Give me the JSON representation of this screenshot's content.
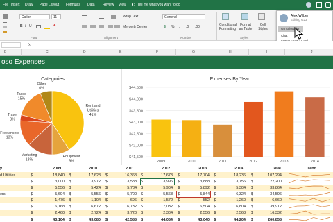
{
  "ribbon_tabs": [
    "File",
    "Insert",
    "Draw",
    "Page Layout",
    "Formulas",
    "Data",
    "Review",
    "View",
    "Help"
  ],
  "tell_me": "Tell me what you want to do",
  "ribbon": {
    "font_name": "Calibri",
    "font_size": "11",
    "wrap_text": "Wrap Text",
    "number_format": "General",
    "merge_center": "Merge & Center",
    "conditional_formatting": "Conditional Formatting",
    "format_as_table": "Format as Table",
    "cell_styles": "Cell Styles",
    "groups": [
      "Font",
      "Alignment",
      "Number",
      "Styles"
    ]
  },
  "presence": {
    "name": "Alex Wilber",
    "status": "Editing G23",
    "goto": "Go to location",
    "chat": "Chat",
    "open": "Open Contact Card"
  },
  "columns": [
    "B",
    "C",
    "D",
    "E",
    "F",
    "G",
    "H",
    "I",
    "J"
  ],
  "banner_title": "oso Expenses",
  "pie": {
    "title": "Categories",
    "slices": [
      {
        "label": "Rent and Utilities",
        "pct": "41%",
        "value": 41,
        "color": "#f9c30f"
      },
      {
        "label": "Equipment",
        "pct": "9%",
        "value": 9,
        "color": "#e5a43d"
      },
      {
        "label": "Marketing",
        "pct": "13%",
        "value": 13,
        "color": "#c8643b"
      },
      {
        "label": "Freelancers",
        "pct": "13%",
        "value": 13,
        "color": "#e9672a"
      },
      {
        "label": "Travel",
        "pct": "3%",
        "value": 3,
        "color": "#d9451c"
      },
      {
        "label": "Taxes",
        "pct": "15%",
        "value": 15,
        "color": "#f08a2b"
      },
      {
        "label": "Other",
        "pct": "6%",
        "value": 6,
        "color": "#b18817"
      }
    ]
  },
  "chart_data": {
    "type": "bar",
    "title": "Expenses By Year",
    "categories": [
      "2009",
      "2010",
      "2011",
      "2012",
      "2013",
      "2014"
    ],
    "values": [
      43104,
      43080,
      42885,
      43871,
      44332,
      44075
    ],
    "colors": [
      "#f9c30f",
      "#f5b013",
      "#d88f3c",
      "#e2571e",
      "#f07c1e",
      "#c96b47"
    ],
    "yticks": [
      "$44,500",
      "$44,000",
      "$43,500",
      "$43,000",
      "$42,500",
      "$42,000",
      "$41,500"
    ],
    "ylim": [
      41500,
      44500
    ],
    "xlabel": "",
    "ylabel": ""
  },
  "table": {
    "headers": [
      "y",
      "2009",
      "2010",
      "2011",
      "2012",
      "2013",
      "2014",
      "Total",
      "Trend"
    ],
    "rows": [
      {
        "label": "d Utilities",
        "values": [
          "18,840",
          "17,628",
          "16,368",
          "17,678",
          "17,704",
          "18,236"
        ],
        "total": "107,294"
      },
      {
        "label": "",
        "values": [
          "3,000",
          "3,972",
          "3,588",
          "3,996",
          "3,888",
          "3,756"
        ],
        "total": "22,200"
      },
      {
        "label": "",
        "values": [
          "5,556",
          "5,424",
          "5,784",
          "5,904",
          "5,892",
          "5,304"
        ],
        "total": "33,864"
      },
      {
        "label": "ers",
        "values": [
          "5,604",
          "5,556",
          "5,700",
          "5,568",
          "5,844",
          "6,324"
        ],
        "total": "34,596"
      },
      {
        "label": "",
        "values": [
          "1,476",
          "1,104",
          "696",
          "1,572",
          "552",
          "1,260"
        ],
        "total": "6,660"
      },
      {
        "label": "",
        "values": [
          "6,168",
          "6,672",
          "6,732",
          "7,032",
          "6,504",
          "6,804"
        ],
        "total": "39,912"
      },
      {
        "label": "",
        "values": [
          "2,460",
          "2,724",
          "3,720",
          "2,304",
          "2,556",
          "2,568"
        ],
        "total": "16,332"
      }
    ],
    "totals": {
      "label": "",
      "values": [
        "43,104",
        "43,080",
        "42,588",
        "44,054",
        "43,040",
        "44,204"
      ],
      "total": "260,858"
    }
  }
}
